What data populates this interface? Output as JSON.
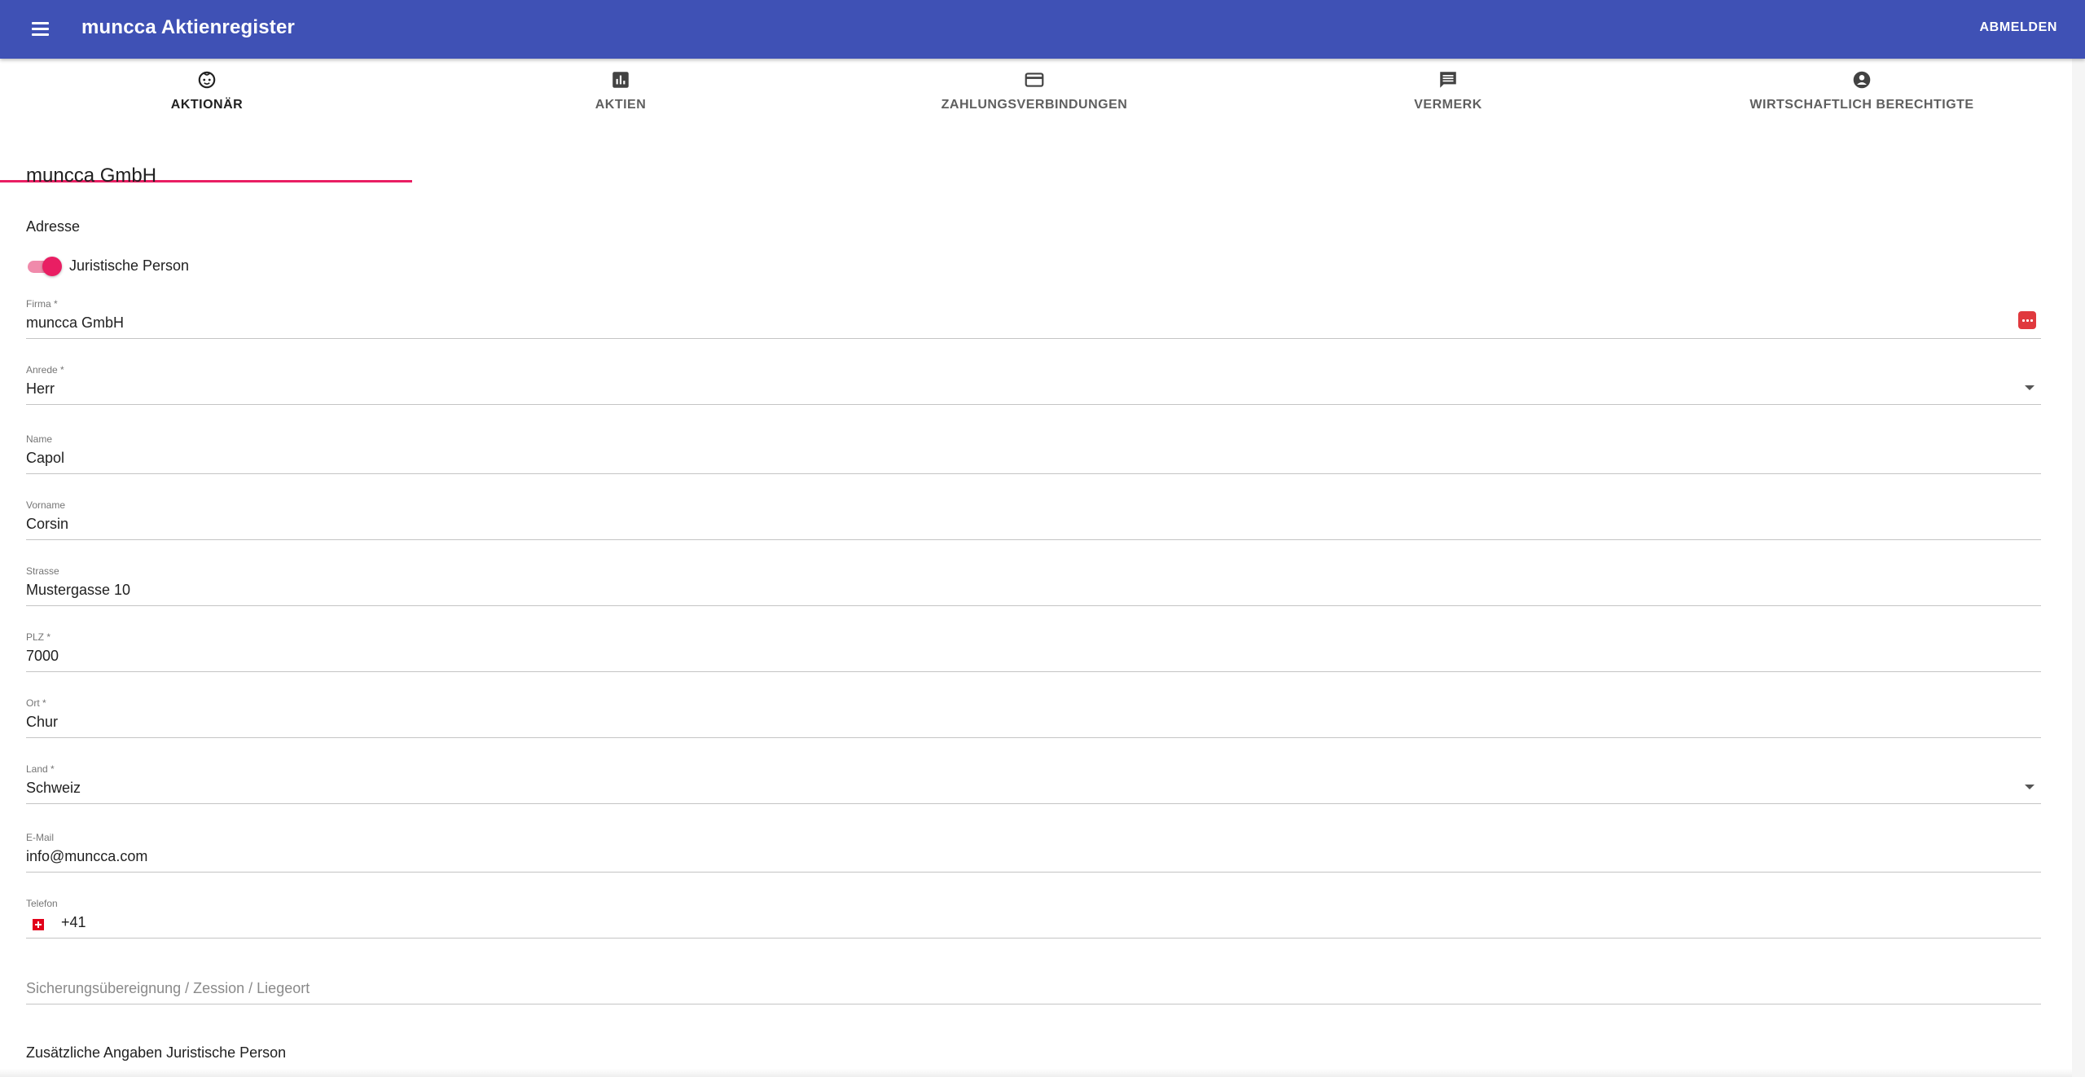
{
  "appbar": {
    "title": "muncca Aktienregister",
    "logout_label": "ABMELDEN",
    "color": "#3f51b5"
  },
  "tabs": [
    {
      "label": "AKTIONÄR",
      "icon": "child-face-icon",
      "active": true
    },
    {
      "label": "AKTIEN",
      "icon": "bar-chart-icon",
      "active": false
    },
    {
      "label": "ZAHLUNGSVERBINDUNGEN",
      "icon": "credit-card-icon",
      "active": false
    },
    {
      "label": "VERMERK",
      "icon": "comment-icon",
      "active": false
    },
    {
      "label": "WIRTSCHAFTLICH BERECHTIGTE",
      "icon": "account-circle-icon",
      "active": false
    }
  ],
  "accent_color": "#e91e63",
  "content": {
    "title": "muncca GmbH",
    "address_section": "Adresse",
    "legal_person_toggle": {
      "label": "Juristische Person",
      "checked": true
    },
    "fields": {
      "firma": {
        "label": "Firma *",
        "value": "muncca GmbH"
      },
      "anrede": {
        "label": "Anrede *",
        "value": "Herr"
      },
      "name": {
        "label": "Name",
        "value": "Capol"
      },
      "vorname": {
        "label": "Vorname",
        "value": "Corsin"
      },
      "strasse": {
        "label": "Strasse",
        "value": "Mustergasse 10"
      },
      "plz": {
        "label": "PLZ *",
        "value": "7000"
      },
      "ort": {
        "label": "Ort *",
        "value": "Chur"
      },
      "land": {
        "label": "Land *",
        "value": "Schweiz"
      },
      "email": {
        "label": "E-Mail",
        "value": "info@muncca.com"
      },
      "telefon": {
        "label": "Telefon",
        "value": "+41",
        "flag": "swiss-flag-icon"
      },
      "sicherung": {
        "placeholder": "Sicherungsübereignung / Zession / Liegeort"
      }
    },
    "additional_section": "Zusätzliche Angaben Juristische Person"
  }
}
